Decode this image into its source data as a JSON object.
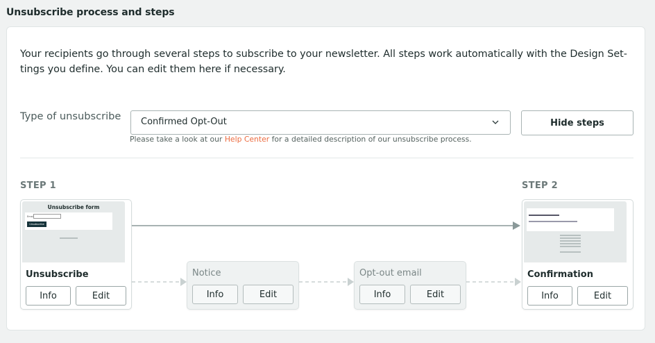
{
  "section_title": "Unsubscribe process and steps",
  "intro_text": "Your recipients go through several steps to subscribe to your newsletter. All steps work automatically with the Design Set- tings you define. You can edit them here if necessary.",
  "type_label": "Type of unsubscribe",
  "select": {
    "value": "Confirmed Opt-Out"
  },
  "hint": {
    "before": "Please take a look at our ",
    "link": "Help Center",
    "after": " for a detailed description of our unsubscribe process."
  },
  "hide_steps_label": "Hide steps",
  "step1_label": "STEP 1",
  "step2_label": "STEP 2",
  "steps": [
    {
      "name": "Unsubscribe",
      "info": "Info",
      "edit": "Edit",
      "thumb_title": "Unsubscribe form",
      "thumb_field": "Email",
      "thumb_button": "Unsubscribe"
    },
    {
      "name": "Notice",
      "info": "Info",
      "edit": "Edit"
    },
    {
      "name": "Opt-out email",
      "info": "Info",
      "edit": "Edit"
    },
    {
      "name": "Confirmation",
      "info": "Info",
      "edit": "Edit"
    }
  ],
  "colors": {
    "accent_link": "#ec6b3f",
    "dark_button": "#16333a",
    "arrow": "#8a9999"
  }
}
